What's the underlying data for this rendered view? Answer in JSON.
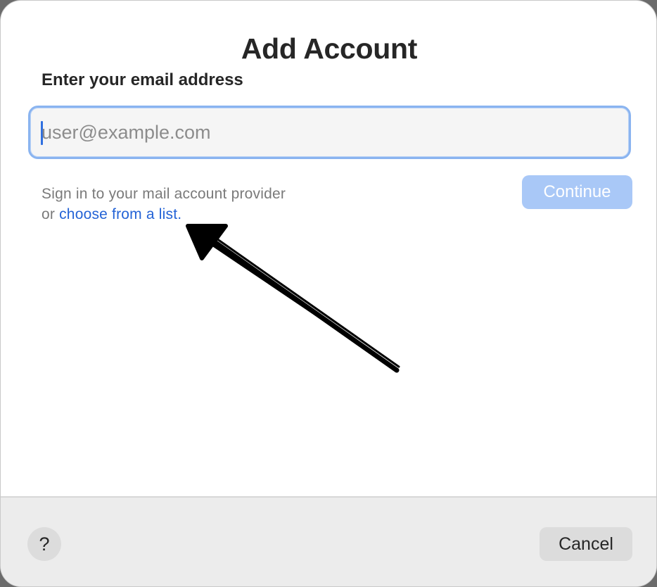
{
  "dialog": {
    "title": "Add Account",
    "subtitle": "Enter your email address"
  },
  "email": {
    "placeholder": "user@example.com",
    "value": ""
  },
  "hint": {
    "line1": "Sign in to your mail account provider",
    "line2_prefix": "or ",
    "link_label": "choose from a list."
  },
  "buttons": {
    "continue_label": "Continue",
    "help_label": "?",
    "cancel_label": "Cancel"
  },
  "colors": {
    "accent": "#2463d6",
    "focus_ring": "#8ab4f0",
    "continue_disabled": "#a9c8f7",
    "annotation": "#000000"
  },
  "icons": {
    "annotation": "hand-drawn-arrow-icon"
  }
}
